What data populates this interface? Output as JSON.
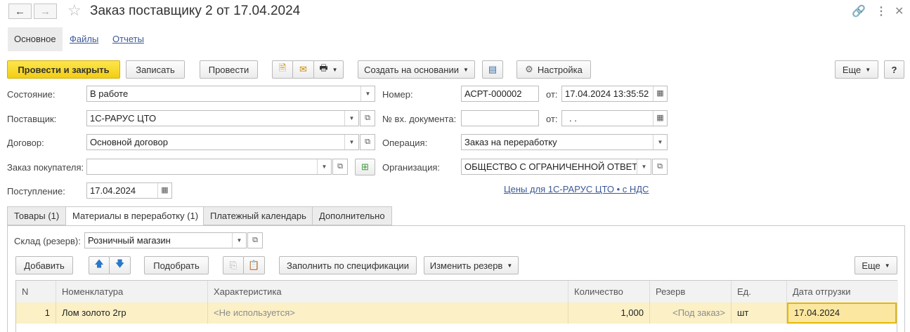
{
  "window": {
    "title": "Заказ поставщику 2 от 17.04.2024",
    "back_label": "←",
    "forward_label": "→"
  },
  "top_tabs": {
    "main": "Основное",
    "files": "Файлы",
    "reports": "Отчеты"
  },
  "toolbar": {
    "post_close": "Провести и закрыть",
    "save": "Записать",
    "post": "Провести",
    "create_based": "Создать на основании",
    "settings": "Настройка",
    "more": "Еще",
    "help": "?"
  },
  "form": {
    "state_label": "Состояние:",
    "state_value": "В работе",
    "supplier_label": "Поставщик:",
    "supplier_value": "1С-РАРУС ЦТО",
    "contract_label": "Договор:",
    "contract_value": "Основной договор",
    "customer_order_label": "Заказ покупателя:",
    "customer_order_value": "",
    "receipt_label": "Поступление:",
    "receipt_value": "17.04.2024",
    "number_label": "Номер:",
    "number_value": "АСРТ-000002",
    "from_label": "от:",
    "date_value": "17.04.2024 13:35:52",
    "in_doc_label": "№ вх. документа:",
    "in_doc_value": "",
    "from_label2": "от:",
    "in_doc_date": " .  .",
    "operation_label": "Операция:",
    "operation_value": "Заказ на переработку",
    "org_label": "Организация:",
    "org_value": "ОБЩЕСТВО С ОГРАНИЧЕННОЙ ОТВЕТ",
    "prices_link": "Цены для 1С-РАРУС ЦТО • с НДС"
  },
  "sub_tabs": [
    "Товары (1)",
    "Материалы в переработку (1)",
    "Платежный календарь",
    "Дополнительно"
  ],
  "materials": {
    "warehouse_label": "Склад (резерв):",
    "warehouse_value": "Розничный магазин",
    "add": "Добавить",
    "pick": "Подобрать",
    "fill_spec": "Заполнить по спецификации",
    "change_reserve": "Изменить резерв",
    "more": "Еще"
  },
  "table": {
    "columns": [
      "N",
      "Номенклатура",
      "Характеристика",
      "Количество",
      "Резерв",
      "Ед.",
      "Дата отгрузки"
    ],
    "rows": [
      {
        "n": "1",
        "item": "Лом золото 2гр",
        "characteristic": "<Не используется>",
        "qty": "1,000",
        "reserve": "<Под заказ>",
        "unit": "шт",
        "ship_date": "17.04.2024"
      }
    ]
  },
  "colors": {
    "primary_button": "#f5d11c",
    "selected_row": "#fbf0c6",
    "link": "#3b5998"
  }
}
